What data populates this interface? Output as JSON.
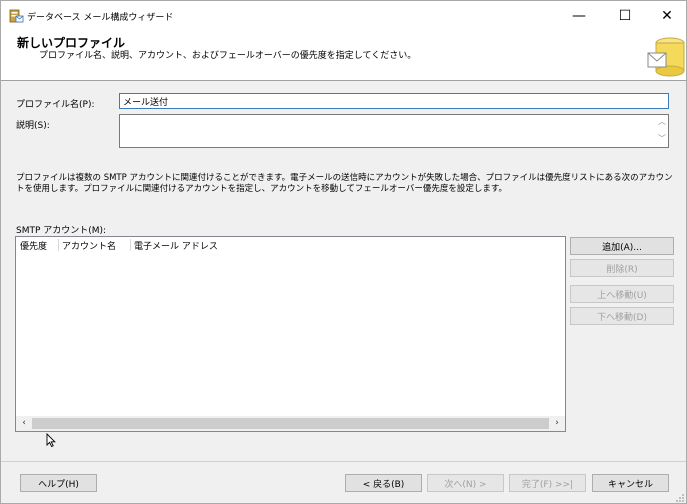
{
  "window": {
    "title": "データベース メール構成ウィザード",
    "minimize_glyph": "—",
    "maximize_glyph": "☐",
    "close_glyph": "✕"
  },
  "header": {
    "title": "新しいプロファイル",
    "subtitle": "プロファイル名、説明、アカウント、およびフェールオーバーの優先度を指定してください。"
  },
  "form": {
    "profile_name_label": "プロファイル名(P):",
    "profile_name_value": "メール送付",
    "description_label": "説明(S):",
    "description_value": ""
  },
  "info_text": "プロファイルは複数の SMTP アカウントに関連付けることができます。電子メールの送信時にアカウントが失敗した場合、プロファイルは優先度リストにある次のアカウントを使用します。プロファイルに関連付けるアカウントを指定し、アカウントを移動してフェールオーバー優先度を設定します。",
  "accounts": {
    "label": "SMTP アカウント(M):",
    "columns": [
      "優先度",
      "アカウント名",
      "電子メール アドレス"
    ],
    "rows": []
  },
  "side_buttons": {
    "add": "追加(A)...",
    "remove": "削除(R)",
    "move_up": "上へ移動(U)",
    "move_down": "下へ移動(D)"
  },
  "footer": {
    "help": "ヘルプ(H)",
    "back": "< 戻る(B)",
    "next": "次へ(N) >",
    "finish": "完了(F) >>|",
    "cancel": "キャンセル"
  },
  "icons": {
    "app": "database-mail-icon",
    "header_art": "database-mail-wizard-icon",
    "scroll_left": "‹",
    "scroll_right": "›",
    "scroll_up": "︿",
    "scroll_down": "﹀"
  }
}
